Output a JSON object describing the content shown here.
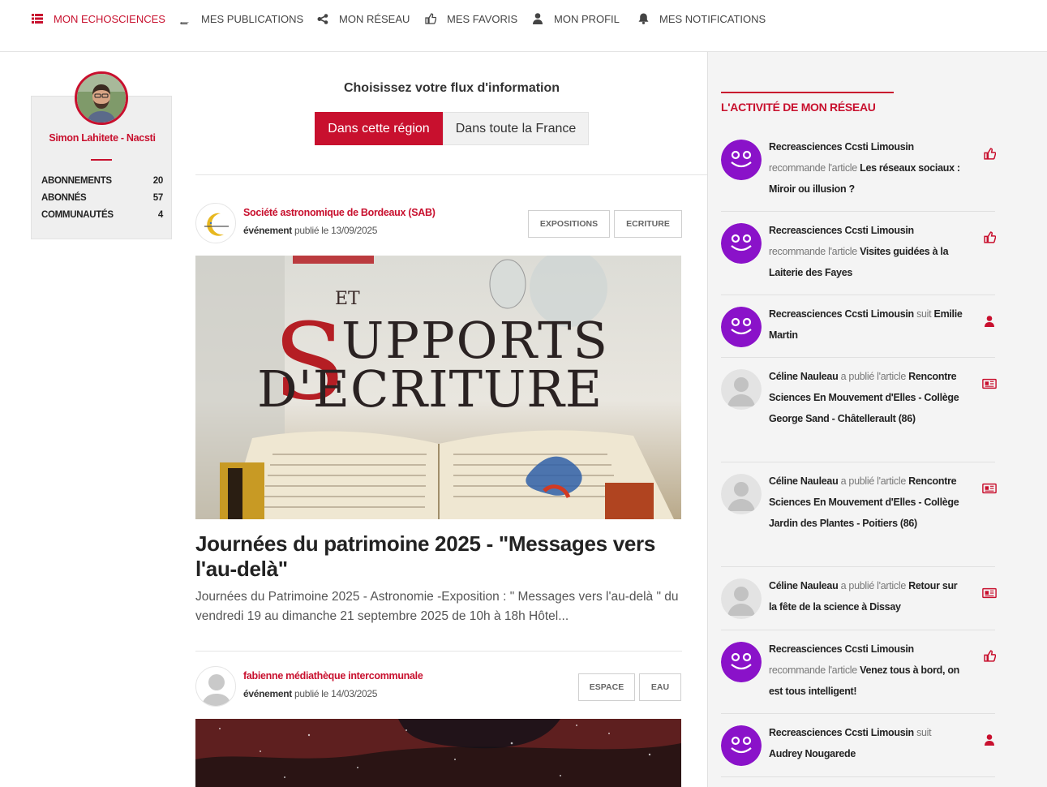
{
  "nav": {
    "items": [
      {
        "label": "MON ECHOSCIENCES",
        "icon": "list-icon",
        "active": true
      },
      {
        "label": "MES PUBLICATIONS",
        "icon": "book-icon"
      },
      {
        "label": "MON RÉSEAU",
        "icon": "share-icon"
      },
      {
        "label": "MES FAVORIS",
        "icon": "thumbs-up-icon"
      },
      {
        "label": "MON PROFIL",
        "icon": "user-icon"
      },
      {
        "label": "MES NOTIFICATIONS",
        "icon": "bell-icon"
      }
    ]
  },
  "profile": {
    "name": "Simon Lahitete - Nacsti",
    "stats": [
      {
        "label": "ABONNEMENTS",
        "value": "20"
      },
      {
        "label": "ABONNÉS",
        "value": "57"
      },
      {
        "label": "COMMUNAUTÉS",
        "value": "4"
      }
    ]
  },
  "feed": {
    "title": "Choisissez votre flux d'information",
    "toggle_region": "Dans cette région",
    "toggle_france": "Dans toute la France",
    "posts": [
      {
        "org": "Société astronomique de Bordeaux (SAB)",
        "kind": "événement",
        "published": "publié le 13/09/2025",
        "tags": [
          "EXPOSITIONS",
          "ECRITURE"
        ],
        "image_text": [
          "ET",
          "UPPORTS",
          "D'ECRITURE"
        ],
        "image_initial": "S",
        "title": "Journées du patrimoine 2025 - \"Messages vers l'au-delà\"",
        "excerpt": "Journées du Patrimoine 2025 - Astronomie -Exposition : \" Messages vers l'au-delà \" du vendredi 19 au dimanche 21 septembre 2025 de 10h à 18h Hôtel..."
      },
      {
        "org": "fabienne médiathèque intercommunale",
        "kind": "événement",
        "published": "publié le 14/03/2025",
        "tags": [
          "ESPACE",
          "EAU"
        ]
      }
    ]
  },
  "activity": {
    "title": "L'ACTIVITÉ DE MON RÉSEAU",
    "items": [
      {
        "actor": "Recreasciences Ccsti Limousin",
        "verb": "recommande l'article",
        "object": "Les réseaux sociaux : Miroir ou illusion ?",
        "icon": "thumbs-up-icon",
        "avatar": "purple"
      },
      {
        "actor": "Recreasciences Ccsti Limousin",
        "verb": "recommande l'article",
        "object": "Visites guidées à la Laiterie des Fayes",
        "icon": "thumbs-up-icon",
        "avatar": "purple"
      },
      {
        "actor": "Recreasciences Ccsti Limousin",
        "verb": "suit",
        "object": "Emilie Martin",
        "icon": "user-icon",
        "avatar": "purple"
      },
      {
        "actor": "Céline Nauleau",
        "verb": "a publié l'article",
        "object": "Rencontre Sciences En Mouvement d'Elles - Collège George Sand - Châtellerault (86)",
        "icon": "newspaper-icon",
        "avatar": "grey"
      },
      {
        "actor": "Céline Nauleau",
        "verb": "a publié l'article",
        "object": "Rencontre Sciences En Mouvement d'Elles - Collège Jardin des Plantes - Poitiers (86)",
        "icon": "newspaper-icon",
        "avatar": "grey"
      },
      {
        "actor": "Céline Nauleau",
        "verb": "a publié l'article",
        "object": "Retour sur la fête de la science à Dissay",
        "icon": "newspaper-icon",
        "avatar": "grey"
      },
      {
        "actor": "Recreasciences Ccsti Limousin",
        "verb": "recommande l'article",
        "object": "Venez tous à bord, on est tous intelligent!",
        "icon": "thumbs-up-icon",
        "avatar": "purple"
      },
      {
        "actor": "Recreasciences Ccsti Limousin",
        "verb": "suit",
        "object": "Audrey Nougarede",
        "icon": "user-icon",
        "avatar": "purple"
      }
    ]
  },
  "colors": {
    "accent": "#c8102e",
    "purple": "#8a12c9"
  }
}
